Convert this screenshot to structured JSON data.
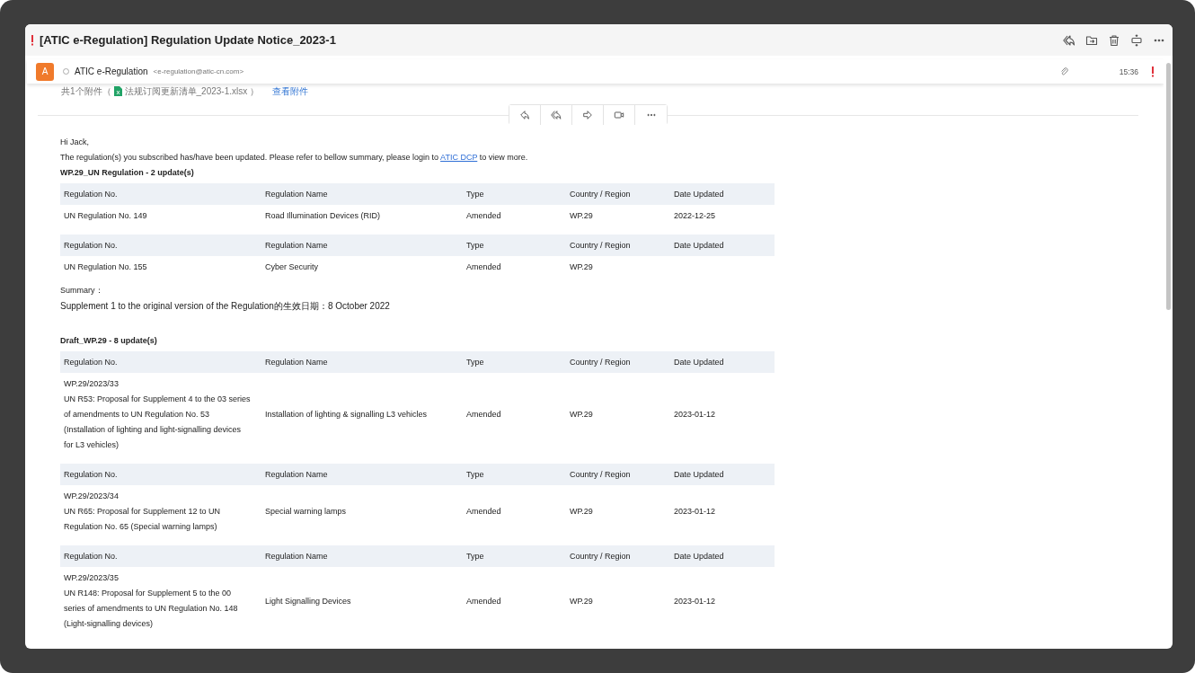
{
  "window": {
    "title": "[ATIC e-Regulation] Regulation Update Notice_2023-1",
    "important": true
  },
  "sender": {
    "avatar": "A",
    "name": "ATIC e-Regulation",
    "email": "<e-regulation@atic-cn.com>",
    "has_attachment": true,
    "time": "15:36",
    "important": true
  },
  "attachments": {
    "summary": "共1个附件（",
    "file": "法规订阅更新清单_2023-1.xlsx",
    "close": "）",
    "view": "查看附件"
  },
  "message": {
    "greeting": "Hi Jack,",
    "intro_before": "The regulation(s) you subscribed has/have been updated. Please refer to bellow summary, please login to",
    "link": "ATIC DCP",
    "intro_after": "to view more.",
    "sections": [
      {
        "heading": "WP.29_UN Regulation - 2 update(s)",
        "tables": [
          {
            "columns": [
              "Regulation No.",
              "Regulation Name",
              "Type",
              "Country / Region",
              "Date Updated"
            ],
            "row": {
              "regulation_no": [
                "UN Regulation No. 149"
              ],
              "regulation_name": "Road Illumination Devices (RID)",
              "type": "Amended",
              "country_region": "WP.29",
              "date_updated": "2022-12-25"
            }
          },
          {
            "columns": [
              "Regulation No.",
              "Regulation Name",
              "Type",
              "Country / Region",
              "Date Updated"
            ],
            "row": {
              "regulation_no": [
                "UN Regulation No. 155"
              ],
              "regulation_name": "Cyber Security",
              "type": "Amended",
              "country_region": "WP.29"
            }
          }
        ],
        "summary_label": "Summary：",
        "summary": "Supplement 1 to the original version of the Regulation的生效日期：8 October 2022"
      },
      {
        "heading": "Draft_WP.29 - 8 update(s)",
        "tables": [
          {
            "columns": [
              "Regulation No.",
              "Regulation Name",
              "Type",
              "Country / Region",
              "Date Updated"
            ],
            "row": {
              "regulation_no": [
                "WP.29/2023/33",
                "UN R53: Proposal for Supplement 4 to the 03 series",
                "of amendments to UN Regulation No. 53",
                "(Installation of lighting and light-signalling devices",
                "for L3 vehicles)"
              ],
              "regulation_name": "Installation of lighting & signalling L3 vehicles",
              "type": "Amended",
              "country_region": "WP.29",
              "date_updated": "2023-01-12"
            }
          },
          {
            "columns": [
              "Regulation No.",
              "Regulation Name",
              "Type",
              "Country / Region",
              "Date Updated"
            ],
            "row": {
              "regulation_no": [
                "WP.29/2023/34",
                "UN R65: Proposal for Supplement 12 to UN",
                "Regulation No. 65 (Special warning lamps)"
              ],
              "regulation_name": "Special warning lamps",
              "type": "Amended",
              "country_region": "WP.29",
              "date_updated": "2023-01-12"
            }
          },
          {
            "columns": [
              "Regulation No.",
              "Regulation Name",
              "Type",
              "Country / Region",
              "Date Updated"
            ],
            "row": {
              "regulation_no": [
                "WP.29/2023/35",
                "UN R148: Proposal for Supplement 5 to the 00",
                "series of amendments to UN Regulation No. 148",
                "(Light-signalling devices)"
              ],
              "regulation_name": "Light Signalling Devices",
              "type": "Amended",
              "country_region": "WP.29",
              "date_updated": "2023-01-12"
            }
          }
        ]
      }
    ]
  }
}
